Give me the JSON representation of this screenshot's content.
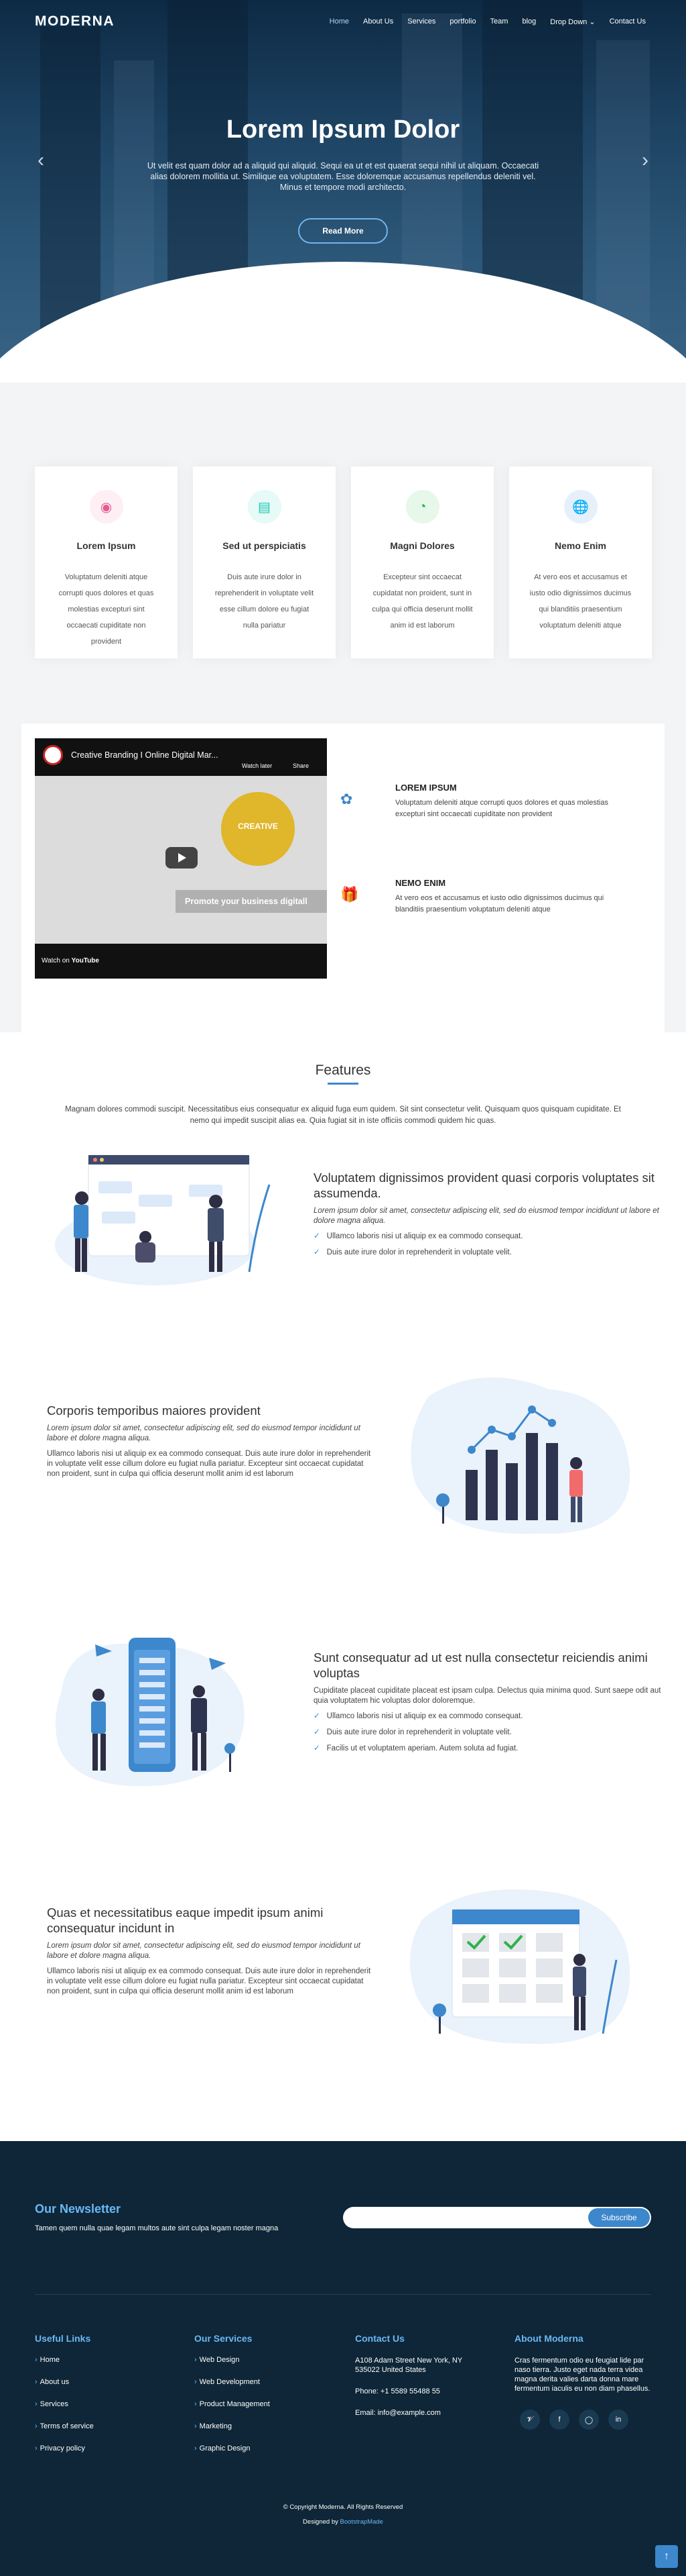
{
  "nav": {
    "logo": "MODERNA",
    "items": [
      "Home",
      "About Us",
      "Services",
      "portfolio",
      "Team",
      "blog",
      "Drop Down",
      "Contact Us"
    ]
  },
  "hero": {
    "title": "Lorem Ipsum Dolor",
    "text": "Ut velit est quam dolor ad a aliquid qui aliquid. Sequi ea ut et est quaerat sequi nihil ut aliquam. Occaecati alias dolorem mollitia ut. Similique ea voluptatem. Esse doloremque accusamus repellendus deleniti vel. Minus et tempore modi architecto.",
    "button": "Read More"
  },
  "icon_boxes": [
    {
      "icon": "dribbble-icon",
      "title": "Lorem Ipsum",
      "text": "Voluptatum deleniti atque corrupti quos dolores et quas molestias excepturi sint occaecati cupiditate non provident",
      "color": "#e55a92",
      "bg": "#fdeff4"
    },
    {
      "icon": "file-icon",
      "title": "Sed ut perspiciatis",
      "text": "Duis aute irure dolor in reprehenderit in voluptate velit esse cillum dolore eu fugiat nulla pariatur",
      "color": "#1cc8b2",
      "bg": "#e6faf7"
    },
    {
      "icon": "speedometer-icon",
      "title": "Magni Dolores",
      "text": "Excepteur sint occaecat cupidatat non proident, sunt in culpa qui officia deserunt mollit anim id est laborum",
      "color": "#2eb24b",
      "bg": "#e7f7ea"
    },
    {
      "icon": "globe-icon",
      "title": "Nemo Enim",
      "text": "At vero eos et accusamus et iusto odio dignissimos ducimus qui blanditiis praesentium voluptatum deleniti atque",
      "color": "#3d87cc",
      "bg": "#e6f0fb"
    }
  ],
  "about": {
    "video_title": "Creative Branding I Online Digital Mar...",
    "watch_later": "Watch later",
    "share": "Share",
    "video_logo": "CREATIVE",
    "video_band": "Promote your business digitall",
    "watch_on": "Watch on",
    "youtube": "YouTube",
    "features": [
      {
        "icon": "fingerprint-icon",
        "title": "LOREM IPSUM",
        "text": "Voluptatum deleniti atque corrupti quos dolores et quas molestias excepturi sint occaecati cupiditate non provident"
      },
      {
        "icon": "gift-icon",
        "title": "NEMO ENIM",
        "text": "At vero eos et accusamus et iusto odio dignissimos ducimus qui blanditiis praesentium voluptatum deleniti atque"
      }
    ]
  },
  "features": {
    "title": "Features",
    "intro": "Magnam dolores commodi suscipit. Necessitatibus eius consequatur ex aliquid fuga eum quidem. Sit sint consectetur velit. Quisquam quos quisquam cupiditate. Et nemo qui impedit suscipit alias ea. Quia fugiat sit in iste officiis commodi quidem hic quas.",
    "rows": [
      {
        "title": "Voluptatem dignissimos provident quasi corporis voluptates sit assumenda.",
        "italic": "Lorem ipsum dolor sit amet, consectetur adipiscing elit, sed do eiusmod tempor incididunt ut labore et dolore magna aliqua.",
        "list": [
          "Ullamco laboris nisi ut aliquip ex ea commodo consequat.",
          "Duis aute irure dolor in reprehenderit in voluptate velit."
        ]
      },
      {
        "title": "Corporis temporibus maiores provident",
        "italic": "Lorem ipsum dolor sit amet, consectetur adipiscing elit, sed do eiusmod tempor incididunt ut labore et dolore magna aliqua.",
        "text": "Ullamco laboris nisi ut aliquip ex ea commodo consequat. Duis aute irure dolor in reprehenderit in voluptate velit esse cillum dolore eu fugiat nulla pariatur. Excepteur sint occaecat cupidatat non proident, sunt in culpa qui officia deserunt mollit anim id est laborum"
      },
      {
        "title": "Sunt consequatur ad ut est nulla consectetur reiciendis animi voluptas",
        "text": "Cupiditate placeat cupiditate placeat est ipsam culpa. Delectus quia minima quod. Sunt saepe odit aut quia voluptatem hic voluptas dolor doloremque.",
        "list": [
          "Ullamco laboris nisi ut aliquip ex ea commodo consequat.",
          "Duis aute irure dolor in reprehenderit in voluptate velit.",
          "Facilis ut et voluptatem aperiam. Autem soluta ad fugiat."
        ]
      },
      {
        "title": "Quas et necessitatibus eaque impedit ipsum animi consequatur incidunt in",
        "italic": "Lorem ipsum dolor sit amet, consectetur adipiscing elit, sed do eiusmod tempor incididunt ut labore et dolore magna aliqua.",
        "text": "Ullamco laboris nisi ut aliquip ex ea commodo consequat. Duis aute irure dolor in reprehenderit in voluptate velit esse cillum dolore eu fugiat nulla pariatur. Excepteur sint occaecat cupidatat non proident, sunt in culpa qui officia deserunt mollit anim id est laborum"
      }
    ]
  },
  "footer": {
    "newsletter_title": "Our Newsletter",
    "newsletter_text": "Tamen quem nulla quae legam multos aute sint culpa legam noster magna",
    "subscribe": "Subscribe",
    "useful_title": "Useful Links",
    "useful": [
      "Home",
      "About us",
      "Services",
      "Terms of service",
      "Privacy policy"
    ],
    "services_title": "Our Services",
    "services": [
      "Web Design",
      "Web Development",
      "Product Management",
      "Marketing",
      "Graphic Design"
    ],
    "contact_title": "Contact Us",
    "address1": "A108 Adam Street New York, NY",
    "address2": "535022 United States",
    "phone": "Phone: +1 5589 55488 55",
    "email": "Email: info@example.com",
    "about_title": "About Moderna",
    "about_text": "Cras fermentum odio eu feugiat lide par naso tierra. Justo eget nada terra videa magna derita valies darta donna mare fermentum iaculis eu non diam phasellus.",
    "social": [
      "twitter-icon",
      "facebook-icon",
      "instagram-icon",
      "linkedin-icon"
    ],
    "copyright": "© Copyright Moderna. All Rights Reserved",
    "designed_by": "Designed by",
    "designer": "BootstrapMade"
  }
}
